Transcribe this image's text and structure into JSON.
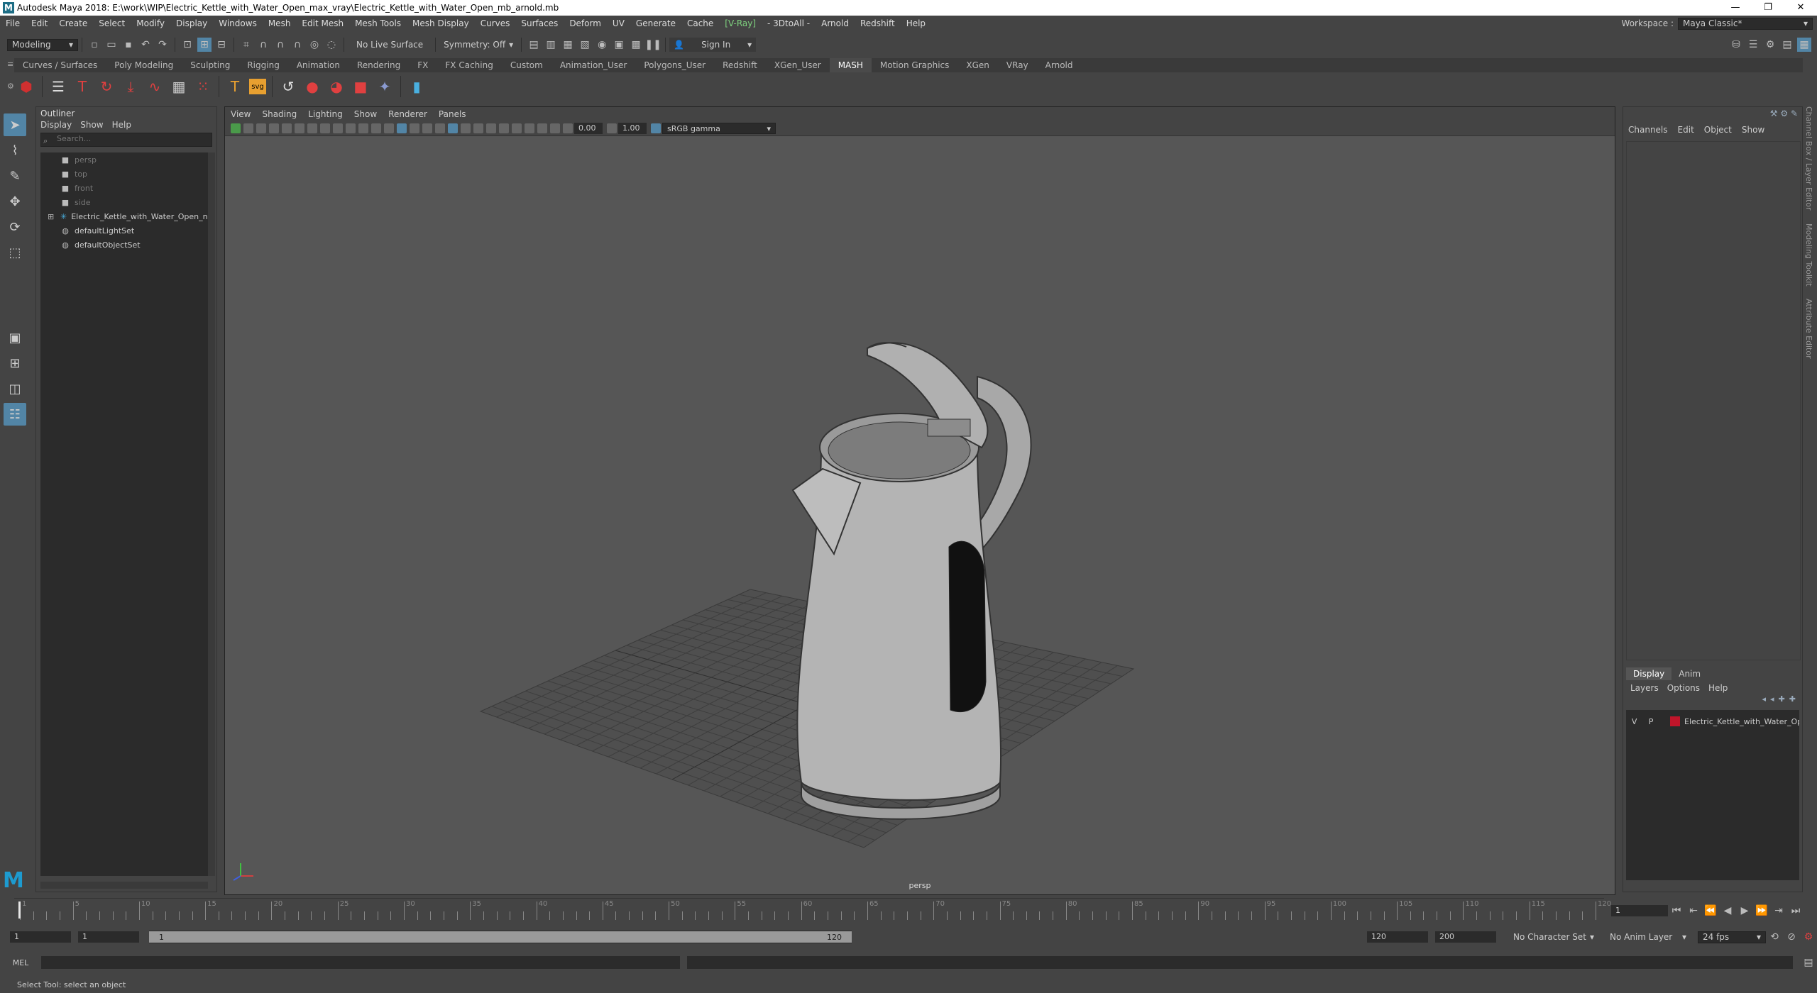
{
  "title_bar": {
    "text": "Autodesk Maya 2018: E:\\work\\WIP\\Electric_Kettle_with_Water_Open_max_vray\\Electric_Kettle_with_Water_Open_mb_arnold.mb",
    "logo": "M",
    "minimize": "—",
    "restore": "❐",
    "close": "✕"
  },
  "menu_bar": {
    "items": [
      "File",
      "Edit",
      "Create",
      "Select",
      "Modify",
      "Display",
      "Windows",
      "Mesh",
      "Edit Mesh",
      "Mesh Tools",
      "Mesh Display",
      "Curves",
      "Surfaces",
      "Deform",
      "UV",
      "Generate",
      "Cache"
    ],
    "vray": "[V-Ray]",
    "items2": [
      "- 3DtoAll -",
      "Arnold",
      "Redshift",
      "Help"
    ],
    "workspace_label": "Workspace :",
    "workspace_value": "Maya Classic*"
  },
  "status_line": {
    "mode": "Modeling",
    "live_surface": "No Live Surface",
    "symmetry": "Symmetry: Off",
    "sign_in": "Sign In"
  },
  "shelf": {
    "tabs": [
      "Curves / Surfaces",
      "Poly Modeling",
      "Sculpting",
      "Rigging",
      "Animation",
      "Rendering",
      "FX",
      "FX Caching",
      "Custom",
      "Animation_User",
      "Polygons_User",
      "Redshift",
      "XGen_User",
      "MASH",
      "Motion Graphics",
      "XGen",
      "VRay",
      "Arnold"
    ],
    "active_tab": "MASH"
  },
  "outliner": {
    "title": "Outliner",
    "menus": [
      "Display",
      "Show",
      "Help"
    ],
    "search_placeholder": "Search...",
    "items": [
      {
        "label": "persp",
        "dim": true
      },
      {
        "label": "top",
        "dim": true
      },
      {
        "label": "front",
        "dim": true
      },
      {
        "label": "side",
        "dim": true
      },
      {
        "label": "Electric_Kettle_with_Water_Open_ncl",
        "dim": false
      },
      {
        "label": "defaultLightSet",
        "dim": false
      },
      {
        "label": "defaultObjectSet",
        "dim": false
      }
    ],
    "expand": "⊞"
  },
  "viewport": {
    "menus": [
      "View",
      "Shading",
      "Lighting",
      "Show",
      "Renderer",
      "Panels"
    ],
    "exposure": "0.00",
    "gamma": "1.00",
    "color_space": "sRGB gamma",
    "camera_label": "persp"
  },
  "channel_box": {
    "menus": [
      "Channels",
      "Edit",
      "Object",
      "Show"
    ],
    "layer_tabs": [
      "Display",
      "Anim"
    ],
    "layer_menus": [
      "Layers",
      "Options",
      "Help"
    ],
    "layer": {
      "v": "V",
      "p": "P",
      "name": "Electric_Kettle_with_Water_Op",
      "color": "#c0152a"
    },
    "side_tabs": [
      "Channel Box / Layer Editor",
      "Modeling Toolkit",
      "Attribute Editor"
    ]
  },
  "time_slider": {
    "ticks": [
      1,
      5,
      10,
      15,
      20,
      25,
      30,
      35,
      40,
      45,
      50,
      55,
      60,
      65,
      70,
      75,
      80,
      85,
      90,
      95,
      100,
      105,
      110,
      115,
      120
    ],
    "current_frame": "1"
  },
  "range_slider": {
    "start": "1",
    "anim_start": "1",
    "range_start_label": "1",
    "range_end_label": "120",
    "end": "120",
    "anim_end": "200",
    "character_set": "No Character Set",
    "anim_layer": "No Anim Layer",
    "fps": "24 fps"
  },
  "command_line": {
    "label": "MEL"
  },
  "help_line": {
    "text": "Select Tool: select an object"
  }
}
